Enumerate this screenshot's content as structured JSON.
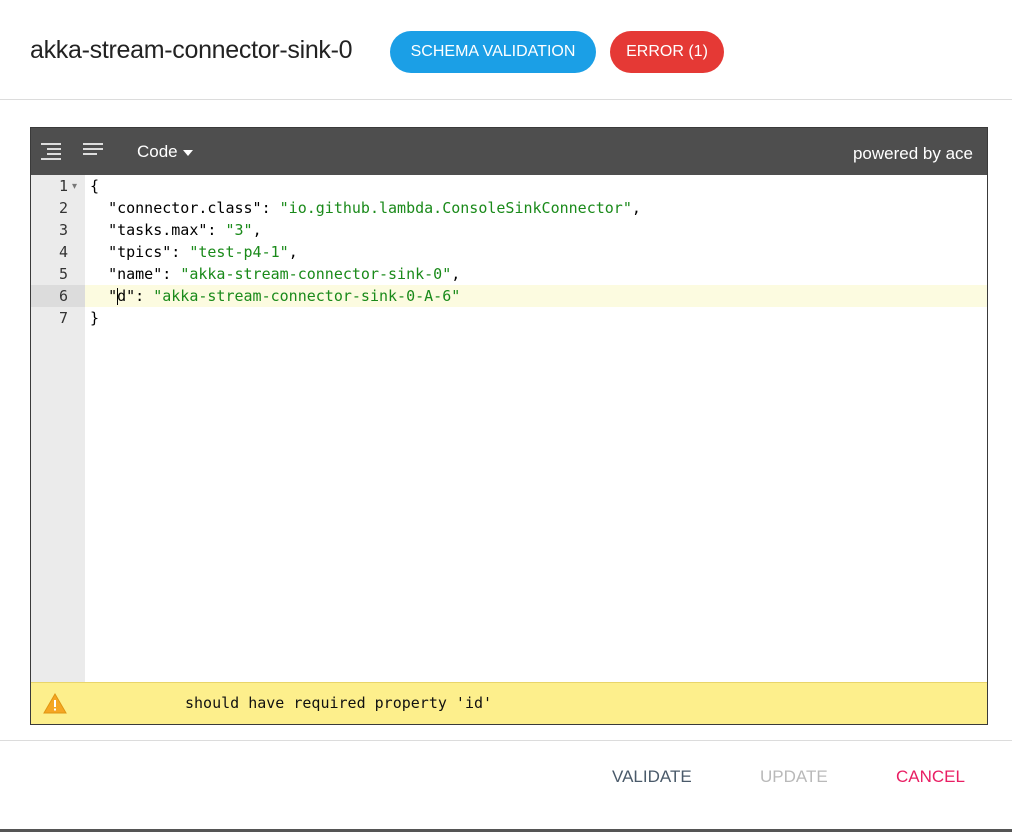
{
  "header": {
    "title": "akka-stream-connector-sink-0",
    "schema_validation_label": "SCHEMA VALIDATION",
    "error_label": "ERROR (1)"
  },
  "editor": {
    "mode_label": "Code",
    "powered_by": "powered by ace",
    "line_numbers": [
      "1",
      "2",
      "3",
      "4",
      "5",
      "6",
      "7"
    ],
    "lines": [
      {
        "punct": "{"
      },
      {
        "key": "\"connector.class\"",
        "value": "\"io.github.lambda.ConsoleSinkConnector\""
      },
      {
        "key": "\"tasks.max\"",
        "value": "\"3\""
      },
      {
        "key": "\"tpics\"",
        "value": "\"test-p4-1\""
      },
      {
        "key": "\"name\"",
        "value": "\"akka-stream-connector-sink-0\""
      },
      {
        "key_pre": "\"",
        "key_post": "d\"",
        "value": "\"akka-stream-connector-sink-0-A-6\""
      },
      {
        "punct": "}"
      }
    ],
    "sep_colon": ": ",
    "sep_comma": ",",
    "status_message": "should have required property 'id'"
  },
  "footer": {
    "validate_label": "VALIDATE",
    "update_label": "UPDATE",
    "cancel_label": "CANCEL"
  },
  "colors": {
    "schema_pill": "#1b9fe6",
    "error_pill": "#e53935",
    "string": "#1a8a1a",
    "cancel": "#e91e63",
    "warning_bar": "#fdef8c"
  }
}
